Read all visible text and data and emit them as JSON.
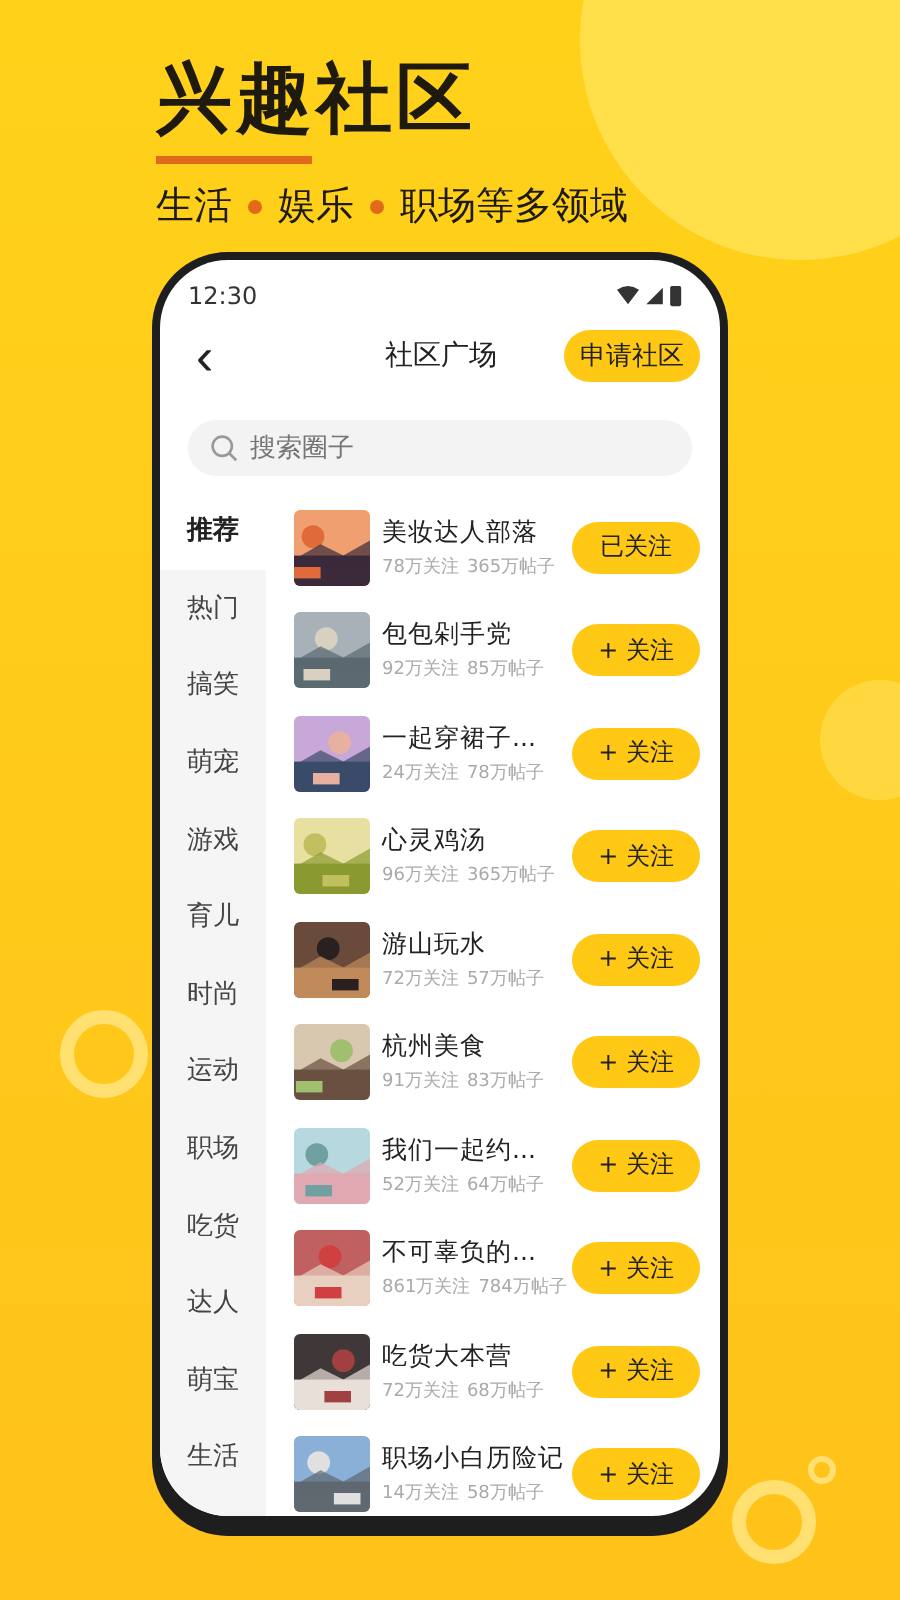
{
  "headline": "兴趣社区",
  "subtitle": [
    "生活",
    "娱乐",
    "职场等多领域"
  ],
  "status_bar": {
    "time": "12:30"
  },
  "header": {
    "back": "‹",
    "title": "社区广场",
    "action": "申请社区"
  },
  "search": {
    "placeholder": "搜索圈子"
  },
  "categories": [
    {
      "label": "推荐",
      "selected": true
    },
    {
      "label": "热门",
      "selected": false
    },
    {
      "label": "搞笑",
      "selected": false
    },
    {
      "label": "萌宠",
      "selected": false
    },
    {
      "label": "游戏",
      "selected": false
    },
    {
      "label": "育儿",
      "selected": false
    },
    {
      "label": "时尚",
      "selected": false
    },
    {
      "label": "运动",
      "selected": false
    },
    {
      "label": "职场",
      "selected": false
    },
    {
      "label": "吃货",
      "selected": false
    },
    {
      "label": "达人",
      "selected": false
    },
    {
      "label": "萌宝",
      "selected": false
    },
    {
      "label": "生活",
      "selected": false
    }
  ],
  "communities": [
    {
      "name": "美妆达人部落",
      "followers": "78万关注",
      "posts": "365万帖子",
      "button": "已关注"
    },
    {
      "name": "包包剁手党",
      "followers": "92万关注",
      "posts": "85万帖子",
      "button": "+ 关注"
    },
    {
      "name": "一起穿裙子...",
      "followers": "24万关注",
      "posts": "78万帖子",
      "button": "+ 关注"
    },
    {
      "name": "心灵鸡汤",
      "followers": "96万关注",
      "posts": "365万帖子",
      "button": "+ 关注"
    },
    {
      "name": "游山玩水",
      "followers": "72万关注",
      "posts": "57万帖子",
      "button": "+ 关注"
    },
    {
      "name": "杭州美食",
      "followers": "91万关注",
      "posts": "83万帖子",
      "button": "+ 关注"
    },
    {
      "name": "我们一起约...",
      "followers": "52万关注",
      "posts": "64万帖子",
      "button": "+ 关注"
    },
    {
      "name": "不可辜负的...",
      "followers": "861万关注",
      "posts": "784万帖子",
      "button": "+ 关注"
    },
    {
      "name": "吃货大本营",
      "followers": "72万关注",
      "posts": "68万帖子",
      "button": "+ 关注"
    },
    {
      "name": "职场小白历险记",
      "followers": "14万关注",
      "posts": "58万帖子",
      "button": "+ 关注"
    }
  ]
}
